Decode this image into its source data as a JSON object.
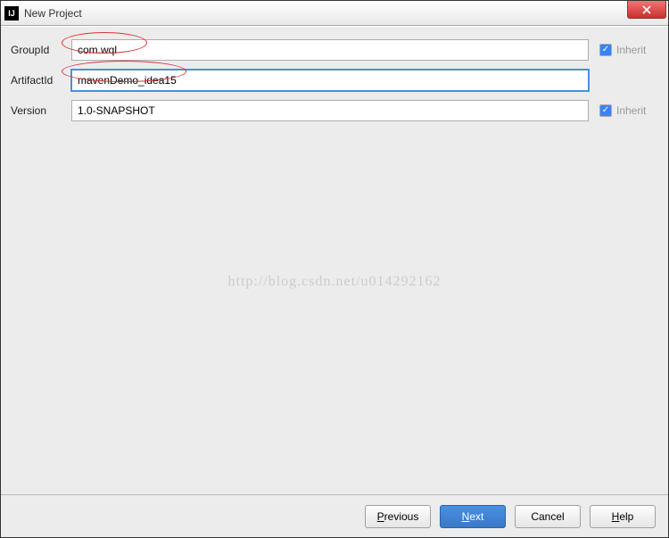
{
  "title": "New Project",
  "fields": {
    "groupId": {
      "label": "GroupId",
      "value": "com.wql",
      "inherit": "Inherit"
    },
    "artifactId": {
      "label": "ArtifactId",
      "value": "mavenDemo_idea15"
    },
    "version": {
      "label": "Version",
      "value": "1.0-SNAPSHOT",
      "inherit": "Inherit"
    }
  },
  "watermark": "http://blog.csdn.net/u014292162",
  "buttons": {
    "previous": "Previous",
    "next": "Next",
    "cancel": "Cancel",
    "help": "Help"
  },
  "mnemonics": {
    "previous": "P",
    "next": "N",
    "help": "H"
  }
}
